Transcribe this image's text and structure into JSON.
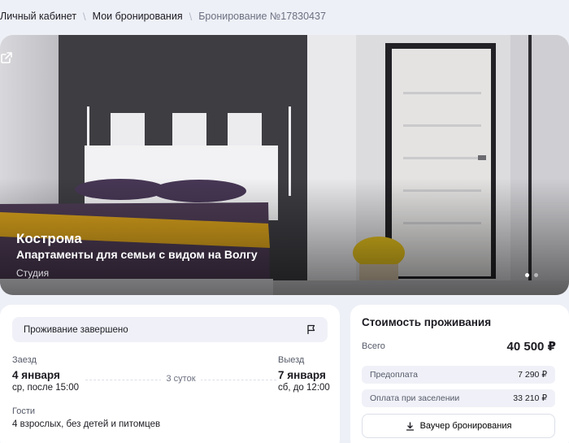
{
  "breadcrumb": {
    "items": [
      "Личный кабинет",
      "Мои бронирования",
      "Бронирование №17830437"
    ]
  },
  "hero": {
    "city": "Кострома",
    "title": "Апартаменты для семьи с видом на Волгу",
    "type": "Студия",
    "slides_total": 2,
    "slide_active": 1,
    "icons": {
      "open": "external-link-icon"
    }
  },
  "stay": {
    "status": "Проживание завершено",
    "status_icon": "flag-icon",
    "checkin_label": "Заезд",
    "checkin_date": "4 января",
    "checkin_time": "ср, после 15:00",
    "nights": "3 суток",
    "checkout_label": "Выезд",
    "checkout_date": "7 января",
    "checkout_time": "сб, до 12:00",
    "guests_label": "Гости",
    "guests_value": "4 взрослых, без детей и питомцев"
  },
  "price": {
    "title": "Стоимость проживания",
    "total_label": "Всего",
    "total_value": "40 500 ₽",
    "prepay_label": "Предоплата",
    "prepay_value": "7 290 ₽",
    "onsite_label": "Оплата при заселении",
    "onsite_value": "33 210 ₽",
    "voucher_label": "Ваучер бронирования",
    "voucher_icon": "download-icon"
  },
  "colors": {
    "page_bg": "#eef0f7",
    "card_bg": "#ffffff",
    "chip_bg": "#f0f1f8",
    "text": "#1b1b22",
    "muted": "#555a68"
  }
}
